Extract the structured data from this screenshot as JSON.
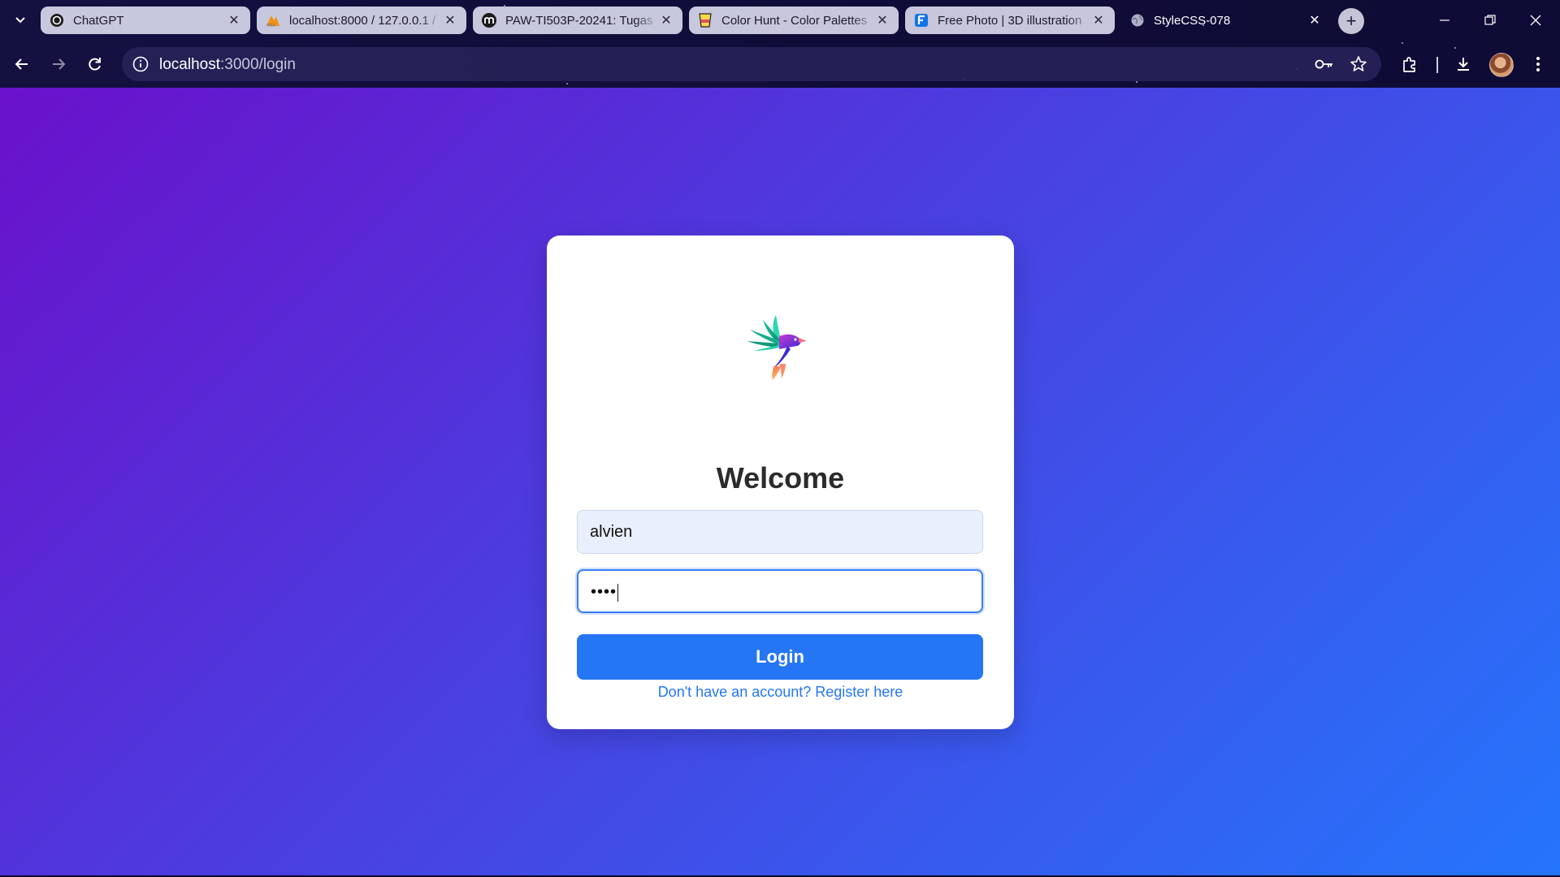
{
  "browser": {
    "tabs": [
      {
        "title": "ChatGPT",
        "icon": "chatgpt-icon",
        "active": false
      },
      {
        "title": "localhost:8000 / 127.0.0.1 / ",
        "icon": "phpmyadmin-icon",
        "active": false
      },
      {
        "title": "PAW-TI503P-20241: Tugas",
        "icon": "moodle-icon",
        "active": false
      },
      {
        "title": "Color Hunt - Color Palettes",
        "icon": "color-hunt-icon",
        "active": false
      },
      {
        "title": "Free Photo | 3D illustration",
        "icon": "freepik-icon",
        "active": false
      },
      {
        "title": "StyleCSS-078",
        "icon": "globe-icon",
        "active": true
      }
    ],
    "url": {
      "host": "localhost",
      "path": ":3000/login"
    }
  },
  "page": {
    "heading": "Welcome",
    "username_value": "alvien",
    "password_mask": "••••",
    "login_label": "Login",
    "register_link": "Don't have an account? Register here"
  },
  "colors": {
    "gradient_start": "#6a11cb",
    "gradient_end": "#2575fc",
    "button": "#2576f5",
    "link": "#2576f5"
  }
}
